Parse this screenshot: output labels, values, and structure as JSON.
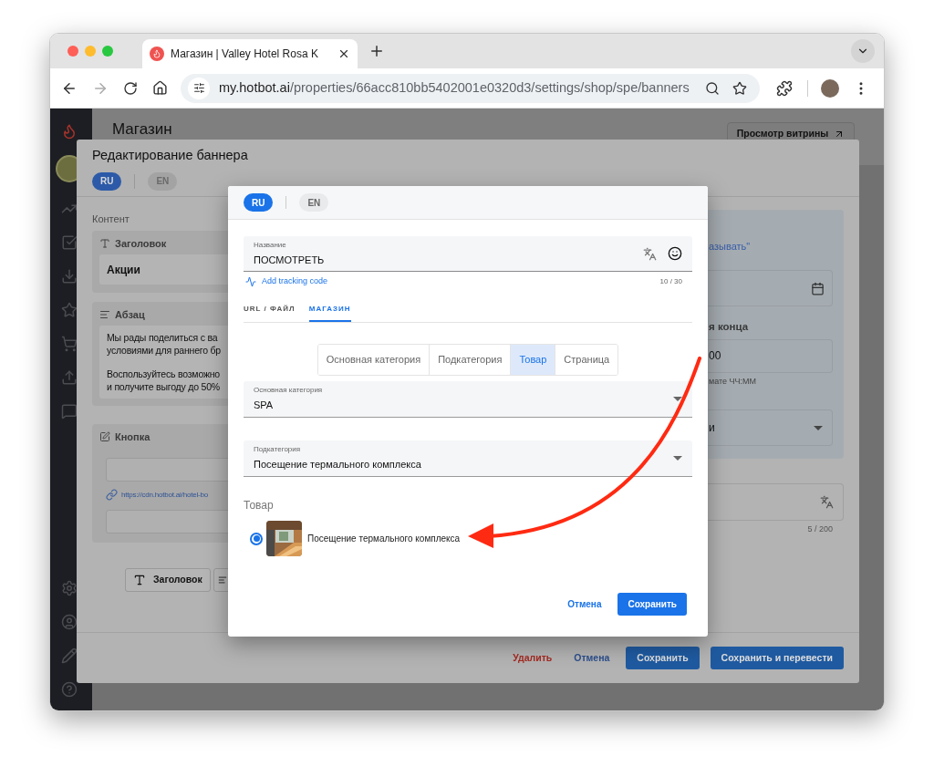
{
  "browser": {
    "tab_title": "Магазин | Valley Hotel Rosa K",
    "url_host": "my.hotbot.ai",
    "url_path": "/properties/66acc810bb5402001e0320d3/settings/shop/spe/banners"
  },
  "page": {
    "title": "Магазин",
    "storefront_button": "Просмотр витрины"
  },
  "edit_dialog": {
    "title": "Редактирование баннера",
    "languages": [
      {
        "label": "RU",
        "selected": true
      },
      {
        "label": "EN",
        "selected": false
      }
    ],
    "content_label": "Контент",
    "blocks": [
      {
        "kind": "heading",
        "label": "Заголовок",
        "value": "Акции"
      },
      {
        "kind": "paragraph",
        "label": "Абзац",
        "paragraphs": [
          [
            "Мы рады поделиться с ва",
            "условиями для раннего бр"
          ],
          [
            "Воспользуйтесь возможно",
            "и получите выгоду до 50%"
          ]
        ]
      },
      {
        "kind": "button",
        "label": "Кнопка",
        "link": "https://cdn.hotbot.ai/hotel-bo"
      }
    ],
    "add_buttons": [
      {
        "kind": "heading",
        "label": "Заголовок"
      },
      {
        "kind": "paragraph"
      }
    ],
    "right_column": {
      "link": "азывать\"",
      "end_label": "я конца",
      "time_value": "00",
      "time_hint": "мате ЧЧ:ММ",
      "select_value": "и",
      "counter": "5 / 200"
    },
    "footer": {
      "delete": "Удалить",
      "cancel": "Отмена",
      "save": "Сохранить",
      "save_translate": "Сохранить и перевести"
    }
  },
  "link_dialog": {
    "languages": [
      {
        "label": "RU",
        "selected": true
      },
      {
        "label": "EN",
        "selected": false
      }
    ],
    "name_field": {
      "label": "Название",
      "value": "ПОСМОТРЕТЬ",
      "counter": "10 / 30"
    },
    "tracking_link": "Add tracking code",
    "tabs": [
      {
        "label": "URL / ФАЙЛ",
        "selected": false
      },
      {
        "label": "МАГАЗИН",
        "selected": true
      }
    ],
    "segments": [
      {
        "label": "Основная категория",
        "selected": false
      },
      {
        "label": "Подкатегория",
        "selected": false
      },
      {
        "label": "Товар",
        "selected": true
      },
      {
        "label": "Страница",
        "selected": false
      }
    ],
    "selects": [
      {
        "label": "Основная категория",
        "value": "SPA"
      },
      {
        "label": "Подкатегория",
        "value": "Посещение термального комплекса"
      }
    ],
    "products_label": "Товар",
    "products": [
      {
        "name": "Посещение термального комплекса",
        "selected": true
      }
    ],
    "cancel": "Отмена",
    "save": "Сохранить"
  }
}
